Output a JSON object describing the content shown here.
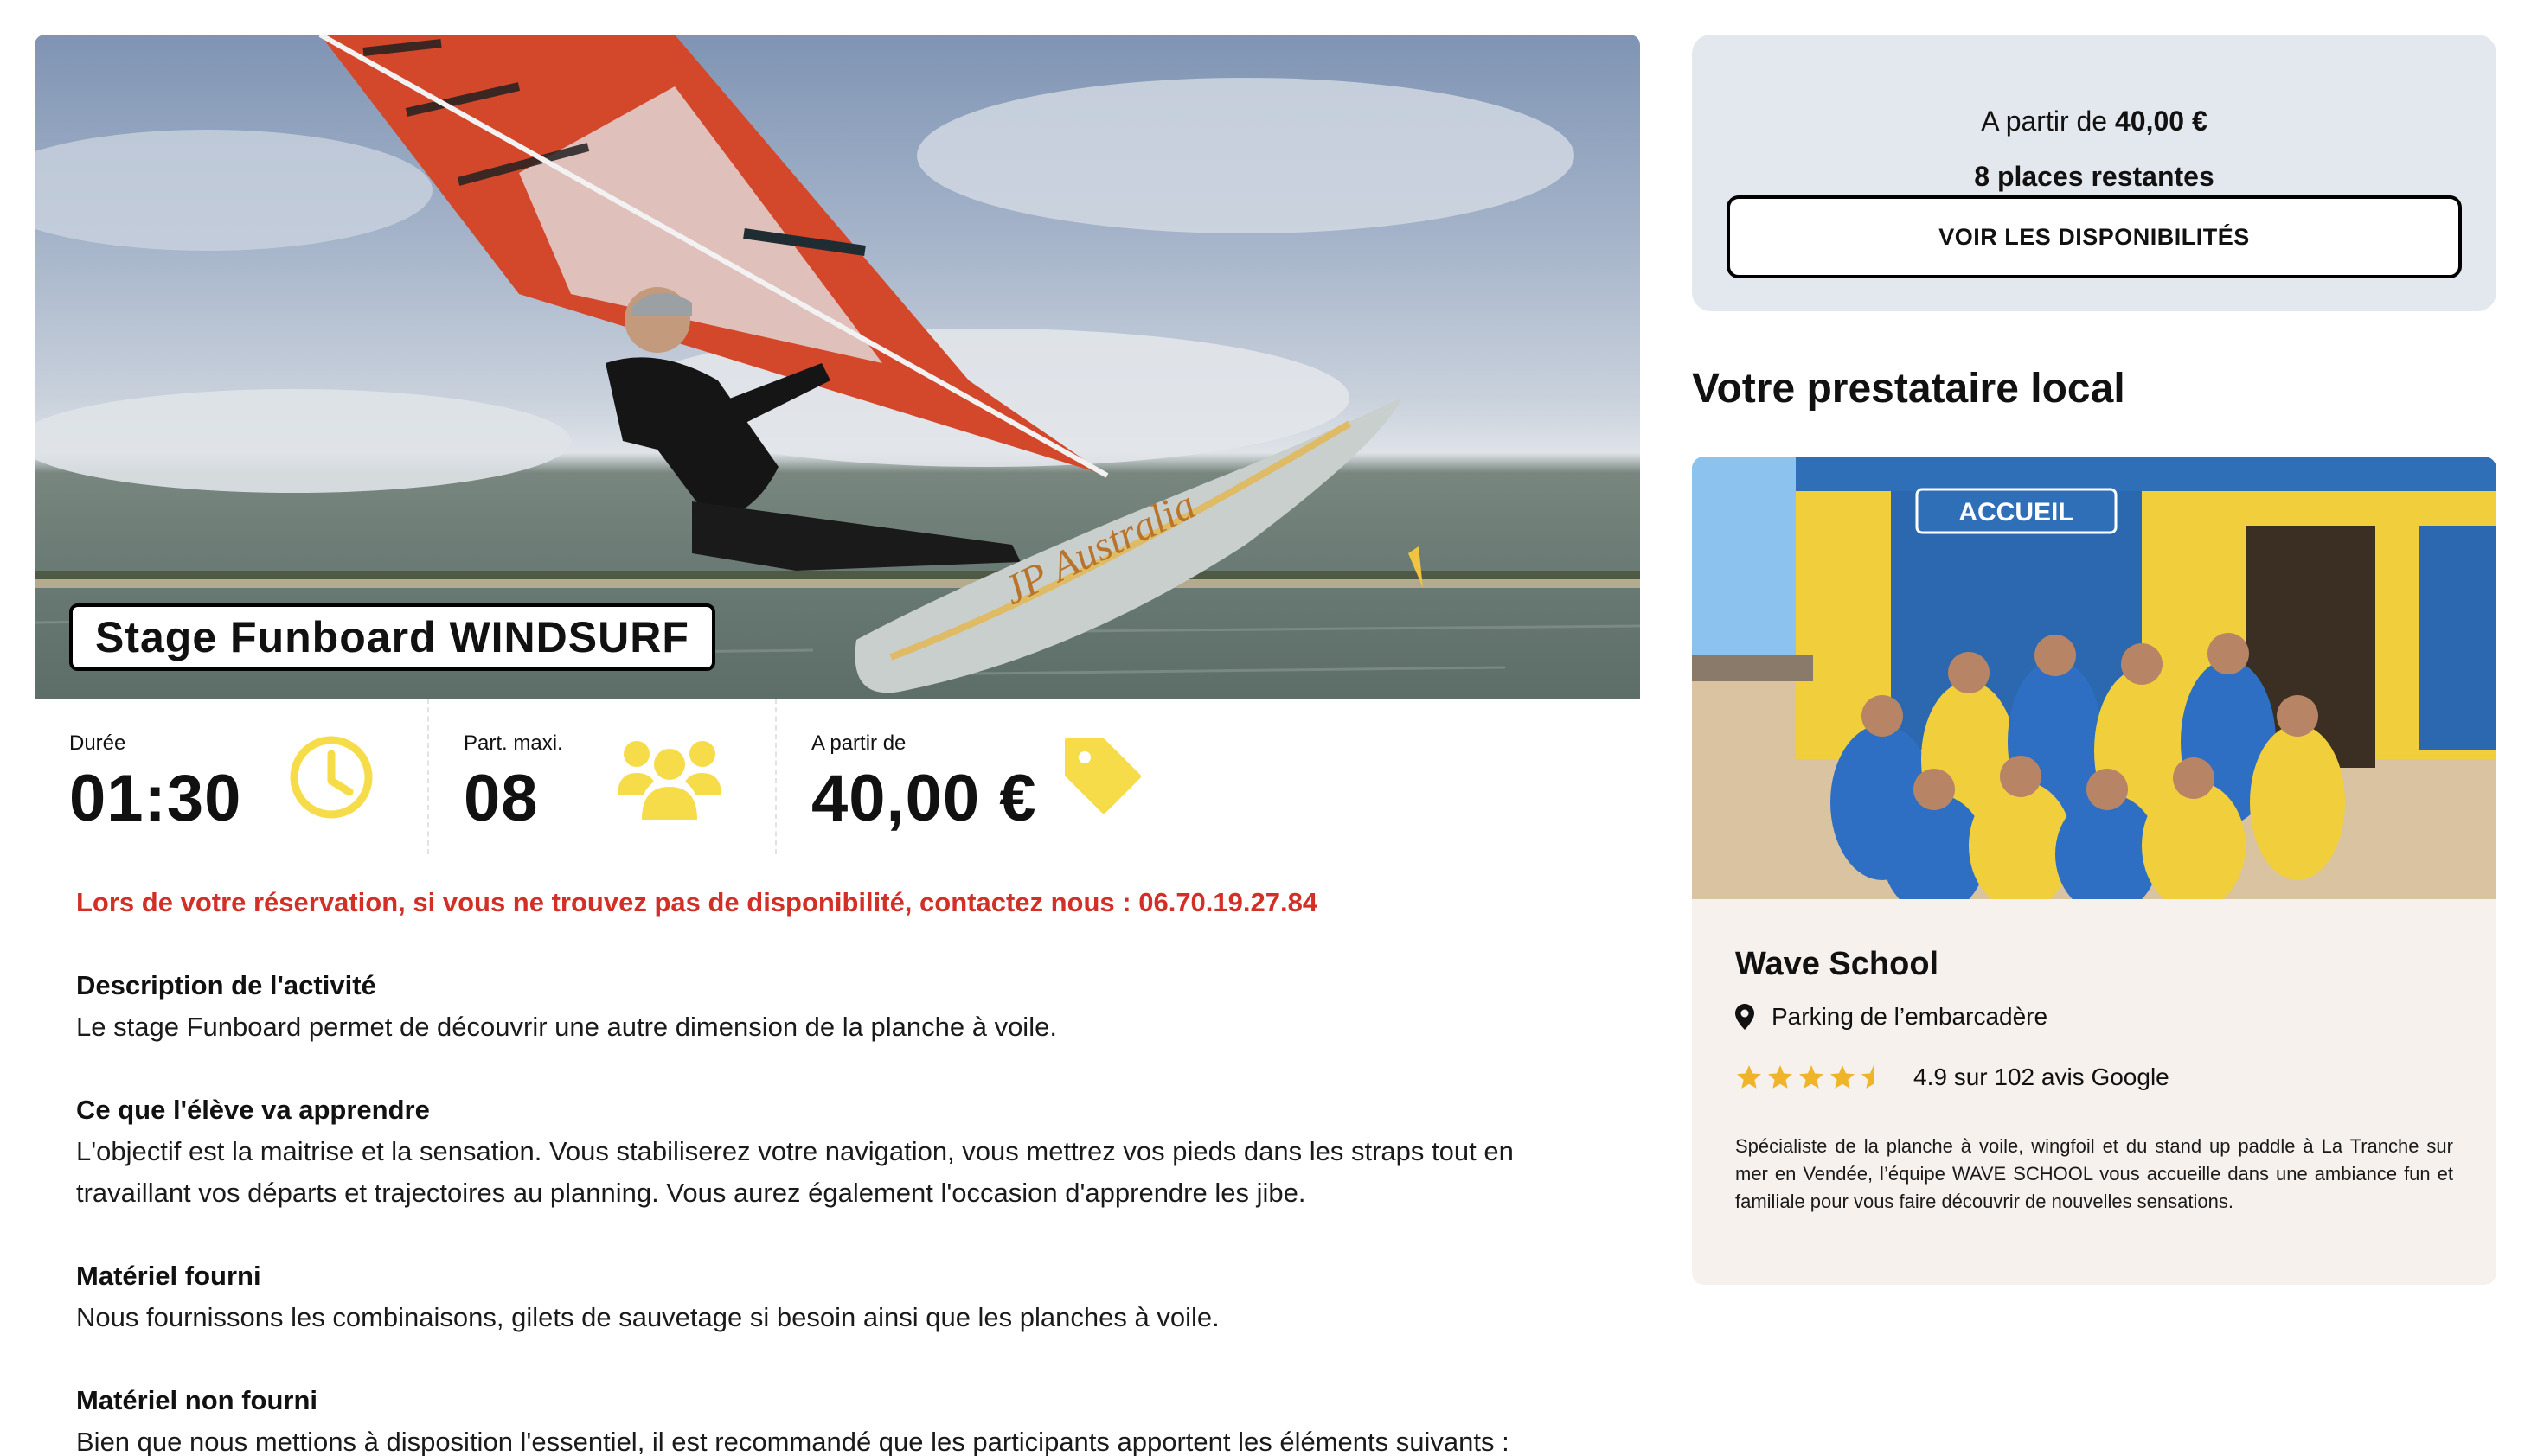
{
  "hero": {
    "title": "Stage Funboard WINDSURF",
    "image": "windsurfer-jumping-photo",
    "sail_brand_text": "JP Australia"
  },
  "stats": [
    {
      "label": "Durée",
      "value": "01:30",
      "icon": "clock-icon"
    },
    {
      "label": "Part. maxi.",
      "value": "08",
      "icon": "users-icon"
    },
    {
      "label": "A partir de",
      "value": "40,00 €",
      "icon": "price-tag-icon"
    }
  ],
  "alert": "Lors de votre réservation, si vous ne trouvez pas de disponibilité, contactez nous : 06.70.19.27.84",
  "sections": [
    {
      "title": "Description de l'activité",
      "text": "Le stage Funboard permet de découvrir une autre dimension de la planche à voile."
    },
    {
      "title": "Ce que l'élève va apprendre",
      "text": "L'objectif est la maitrise et la sensation. Vous stabiliserez votre navigation, vous mettrez vos pieds dans les straps tout en travaillant vos départs et trajectoires au planning. Vous aurez également l'occasion d'apprendre les jibe."
    },
    {
      "title": "Matériel fourni",
      "text": "Nous fournissons les combinaisons, gilets de sauvetage si besoin ainsi que les planches à voile."
    },
    {
      "title": "Matériel non fourni",
      "text": "Bien que nous mettions à disposition l'essentiel, il est recommandé que les participants apportent les éléments suivants :"
    }
  ],
  "booking": {
    "from_label": "A partir de",
    "from_price": "40,00 €",
    "places": "8 places restantes",
    "button": "VOIR LES DISPONIBILITÉS"
  },
  "provider": {
    "heading": "Votre prestataire local",
    "sign_text": "ACCUEIL",
    "name": "Wave School",
    "location": "Parking de l’embarcadère",
    "rating_value": 4.5,
    "rating_text": "4.9 sur 102 avis Google",
    "description": "Spécialiste de la planche à voile, wingfoil et du stand up paddle à La Tranche sur mer en Vendée, l’équipe WAVE SCHOOL vous accueille dans une ambiance fun et familiale pour vous faire découvrir de nouvelles sensations."
  },
  "colors": {
    "accent_yellow": "#f7dc4a",
    "alert_red": "#d22f27",
    "booking_bg": "#e3e8ef",
    "provider_bg": "#f7f1ee",
    "star": "#f0b428"
  }
}
